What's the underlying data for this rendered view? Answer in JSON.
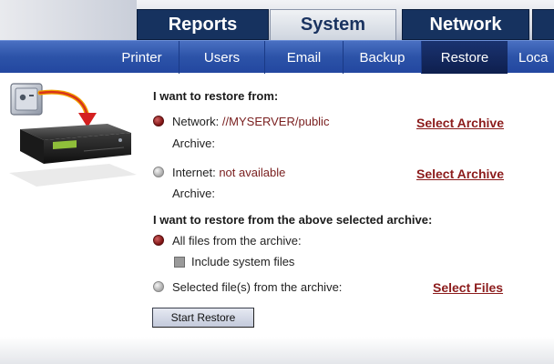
{
  "top_tabs": [
    {
      "label": "Reports",
      "active": false
    },
    {
      "label": "System",
      "active": true
    },
    {
      "label": "Network",
      "active": false
    }
  ],
  "sub_tabs": [
    {
      "label": "Printer",
      "active": false
    },
    {
      "label": "Users",
      "active": false
    },
    {
      "label": "Email",
      "active": false
    },
    {
      "label": "Backup",
      "active": false
    },
    {
      "label": "Restore",
      "active": true
    },
    {
      "label": "Loca",
      "active": false
    }
  ],
  "restore_from": {
    "heading": "I want to restore from:",
    "network": {
      "label": "Network:",
      "value": "//MYSERVER/public",
      "archive_label": "Archive:",
      "link": "Select Archive",
      "selected": true
    },
    "internet": {
      "label": "Internet:",
      "value": "not available",
      "archive_label": "Archive:",
      "link": "Select Archive",
      "selected": false
    }
  },
  "restore_scope": {
    "heading": "I want to restore from the above selected archive:",
    "all_files": {
      "label": "All files from the archive:",
      "selected": true
    },
    "include_system": {
      "label": "Include system files",
      "checked": false
    },
    "selected_files": {
      "label": "Selected file(s) from the archive:",
      "link": "Select Files",
      "selected": false
    }
  },
  "start_button": "Start Restore",
  "colors": {
    "accent": "#2c53a8",
    "dark_tab": "#16325f",
    "link": "#8c1c1c"
  }
}
